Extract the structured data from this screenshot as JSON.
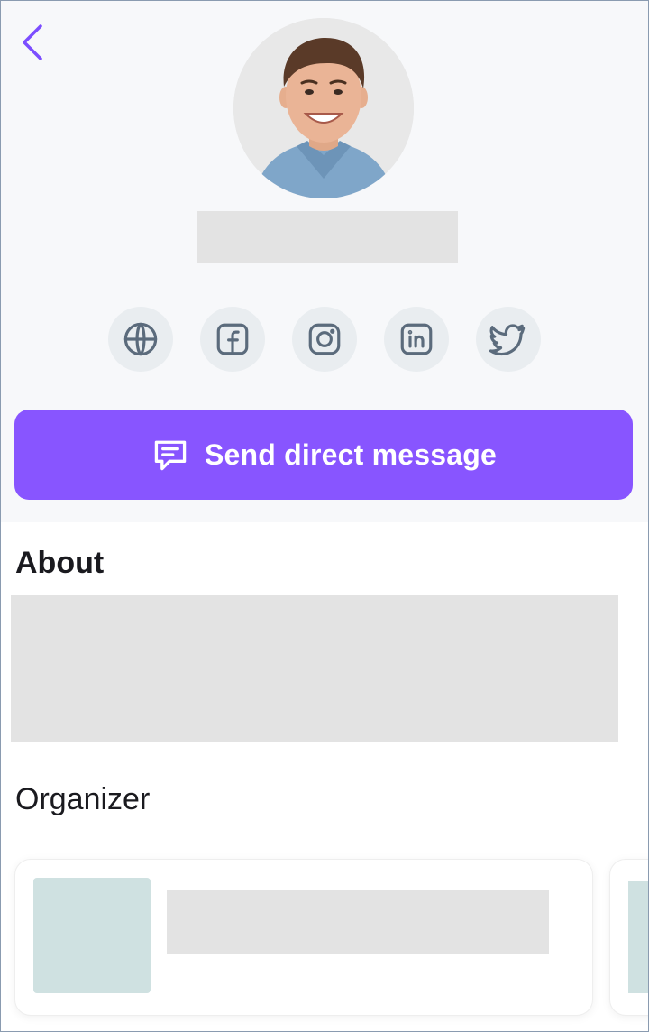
{
  "colors": {
    "accent": "#8855ff",
    "back_arrow": "#7c4dff",
    "social_bg": "#e9edf0",
    "social_icon": "#5b6b7c",
    "skeleton": "#e3e3e3",
    "thumb_skeleton": "#cfe1e1",
    "header_bg": "#f7f8fa"
  },
  "icons": {
    "back": "chevron-left-icon",
    "avatar": "avatar-photo",
    "social": [
      "globe-icon",
      "facebook-icon",
      "instagram-icon",
      "linkedin-icon",
      "twitter-icon"
    ],
    "message": "message-square-icon"
  },
  "profile": {
    "name": ""
  },
  "actions": {
    "send_message_label": "Send direct message"
  },
  "about": {
    "title": "About",
    "text": ""
  },
  "organizer": {
    "title": "Organizer",
    "cards": [
      {
        "name": ""
      },
      {
        "name": ""
      }
    ]
  }
}
